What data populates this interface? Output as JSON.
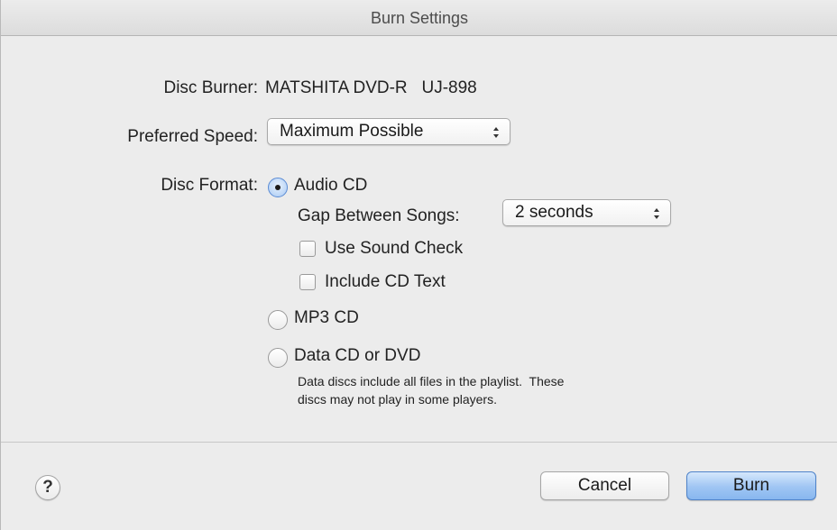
{
  "window": {
    "title": "Burn Settings"
  },
  "form": {
    "disc_burner_label": "Disc Burner:",
    "disc_burner_value": "MATSHITA DVD-R   UJ-898",
    "preferred_speed_label": "Preferred Speed:",
    "preferred_speed_value": "Maximum Possible",
    "disc_format_label": "Disc Format:",
    "formats": {
      "audio_cd": {
        "label": "Audio CD",
        "selected": true
      },
      "mp3_cd": {
        "label": "MP3 CD",
        "selected": false
      },
      "data_cd": {
        "label": "Data CD or DVD",
        "selected": false
      }
    },
    "gap_label": "Gap Between Songs:",
    "gap_value": "2 seconds",
    "use_sound_check": {
      "label": "Use Sound Check",
      "checked": false
    },
    "include_cd_text": {
      "label": "Include CD Text",
      "checked": false
    },
    "data_note_line1": "Data discs include all files in the playlist.  These",
    "data_note_line2": "discs may not play in some players."
  },
  "footer": {
    "help_label": "?",
    "cancel_label": "Cancel",
    "burn_label": "Burn"
  },
  "colors": {
    "window_bg": "#ececec",
    "default_button": "#9fc5f3",
    "radio_selected": "#bcd6f6"
  },
  "icons": {
    "popup_arrows": "updown-arrows-icon",
    "help": "question-icon"
  }
}
